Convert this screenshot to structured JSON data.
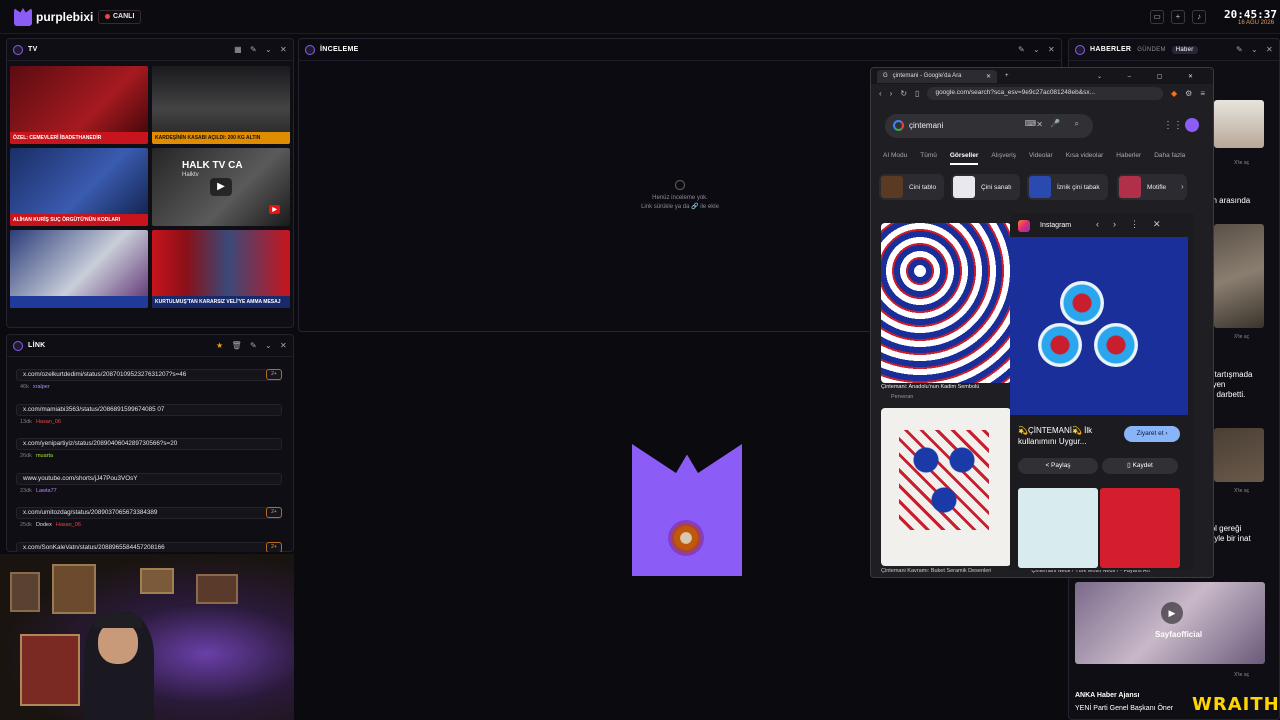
{
  "app": {
    "brand": "purplebixi",
    "live_label": "CANLI",
    "time": "20:45:37",
    "date": "16 AĞU 2026"
  },
  "tv": {
    "title": "TV",
    "tiles": [
      {
        "caption": "ÖZEL: CEMEVLERİ İBADETHANEDİR",
        "title": "",
        "subtitle": ""
      },
      {
        "caption": "KARDEŞİNİN KASABI AÇILDI: 200 KG ALTIN",
        "title": "",
        "subtitle": ""
      },
      {
        "caption": "ALİHAN KURİŞ SUÇ ÖRGÜTÜ'NÜN KODLARI",
        "title": "",
        "subtitle": ""
      },
      {
        "caption": "",
        "title": "HALK TV CA",
        "subtitle": "Halktv"
      },
      {
        "caption": "",
        "title": "",
        "subtitle": ""
      },
      {
        "caption": "KURTULMUŞ'TAN KARARSIZ VELİ'YE AMMA MESAJ",
        "title": "",
        "subtitle": ""
      }
    ]
  },
  "inspect": {
    "title": "İNCELEME",
    "empty_line1": "Henüz inceleme yok.",
    "empty_line2": "Link sürükle ya da 🔗 ile ekle"
  },
  "links": {
    "title": "LİNK",
    "items": [
      {
        "url": "x.com/ozelkurtdedimi/status/2087010952327631207?s=46",
        "age": "46k",
        "user": "xralper",
        "user2": "",
        "count": "2+"
      },
      {
        "url": "x.com/mamiabi3563/status/2086891599674085 07",
        "age": "13dk",
        "user": "Hasan_06",
        "user2": "",
        "count": ""
      },
      {
        "url": "x.com/yenipartiyiz/status/2089040604289730566?s=20",
        "age": "26dk",
        "user": "muarta",
        "user2": "",
        "count": ""
      },
      {
        "url": "www.youtube.com/shorts/jJ47Pou3VOsY",
        "age": "23dk",
        "user": "Lawta77",
        "user2": "",
        "count": ""
      },
      {
        "url": "x.com/umitozdag/status/2089037065673384389",
        "age": "25dk",
        "user": "Dodex",
        "user2": "Hasan_06",
        "count": "2+"
      },
      {
        "url": "x.com/SonKaleVatn/status/2088965584457208166",
        "age": "",
        "user": "",
        "user2": "",
        "count": "2+"
      }
    ]
  },
  "browser": {
    "tab_title": "çintemani - Google'da Ara",
    "url": "google.com/search?sca_esv=9e9c27ac081248eb&sx...",
    "query": "çintemani",
    "tabs": [
      "AI Modu",
      "Tümü",
      "Görseller",
      "Alışveriş",
      "Videolar",
      "Kısa videolar",
      "Haberler",
      "Daha fazla"
    ],
    "active_tab": "Görseller",
    "chips": [
      "Cini tablo",
      "Çini sanatı",
      "İznik çini tabak",
      "Motifle"
    ],
    "result1_title": "Çintemani: Anadolu'nun Kadim Sembolü",
    "result1_source": "Perveran",
    "result2_title": "Çintemani Kavramı: Buket Seramik Desenleri",
    "preview_source": "Instagram",
    "preview_title": "💫ÇİNTEMANİ💫 İlk kullanımını Uygur...",
    "visit_label": "Ziyaret et",
    "share_label": "Paylaş",
    "save_label": "Kaydet",
    "bottom_caption": "Çintemani Nedir? Türk Motifi Nedir? - Fayans Art"
  },
  "news": {
    "title": "HABERLER",
    "tabs": [
      "GÜNDEM",
      "Haber"
    ],
    "items": [
      {
        "text": "",
        "ago": "X'te aç"
      },
      {
        "text": "an arasında",
        "ago": "X'te aç"
      },
      {
        "text": "n tartışmada\neyen\nyı darbetti.",
        "ago": "X'te aç"
      },
      {
        "text": "rol gereği\nÖyle bir inat",
        "ago": "X'te aç"
      },
      {
        "text": "",
        "ago": "X'te aç"
      }
    ],
    "video_caption": "Sayfaofficial",
    "source": "ANKA Haber Ajansı",
    "headline": "YENİ Parti Genel Başkanı Öner"
  },
  "watermark": "WRAITH:",
  "colors": {
    "accent": "#8b5cf6",
    "live": "#ef4444",
    "badge": "#e0a060"
  }
}
